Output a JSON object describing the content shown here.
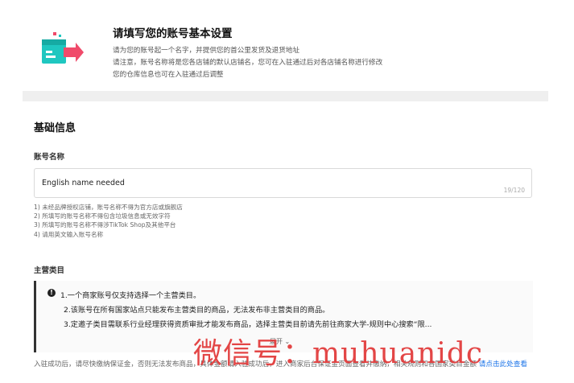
{
  "header": {
    "title": "请填写您的账号基本设置",
    "lines": [
      "请为您的账号起一个名字，并提供您的首公里发货及退货地址",
      "请注意，账号名称将是您各店铺的默认店铺名，您可在入驻通过后对各店铺名称进行修改",
      "您的仓库信息也可在入驻通过后调整"
    ]
  },
  "basic": {
    "section_title": "基础信息",
    "account_label": "账号名称",
    "account_value": "English name needed",
    "counter": "19/120",
    "rules": [
      "1) 未经品牌授权店铺，账号名称不得为官方店或旗舰店",
      "2) 所填写的账号名称不得包含垃圾信息或无效字符",
      "3) 所填写的账号名称不得涉TikTok Shop及其他平台",
      "4) 请用英文输入账号名称"
    ]
  },
  "category": {
    "label": "主营类目",
    "notice": [
      "1.一个商家账号仅支持选择一个主营类目。",
      "2.该账号在所有国家站点只能发布主营类目的商品，无法发布非主营类目的商品。",
      "3.定邀子类目需联系行业经理获得资质审批才能发布商品，选择主营类目前请先前往商家大学-规则中心搜索“限..."
    ],
    "toggle": "展开"
  },
  "bottom": {
    "text": "入驻成功后，请尽快缴纳保证金，否则无法发布商品，具体金额请入驻成功后，进入商家后台保证金页面查看并缴纳，相关规则和各国家类目金额",
    "link": "请点击此处查看"
  },
  "watermark": "微信号：muhuanidc",
  "colors": {
    "accent": "#1a73e8",
    "watermark": "#e23d3d",
    "logo_teal": "#1fc7c0",
    "logo_pink": "#f04a6a"
  }
}
